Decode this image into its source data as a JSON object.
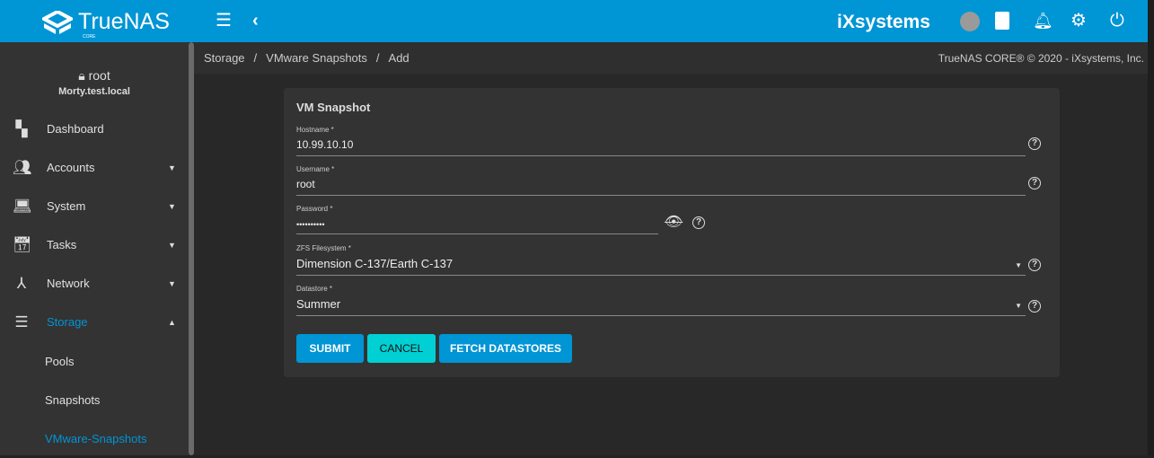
{
  "header": {
    "brand": "TrueNAS",
    "brand_sub": "CORE",
    "vendor": "iXsystems",
    "icons": [
      "menu-icon",
      "chevron-left-icon",
      "truecommand-icon",
      "clipboard-icon",
      "bell-icon",
      "gear-icon",
      "power-icon"
    ]
  },
  "sidebar": {
    "user": "root",
    "host": "Morty.test.local",
    "items": [
      {
        "label": "Dashboard"
      },
      {
        "label": "Accounts"
      },
      {
        "label": "System"
      },
      {
        "label": "Tasks"
      },
      {
        "label": "Network"
      },
      {
        "label": "Storage"
      }
    ],
    "subitems": [
      {
        "label": "Pools"
      },
      {
        "label": "Snapshots"
      },
      {
        "label": "VMware-Snapshots"
      }
    ]
  },
  "breadcrumb": [
    "Storage",
    "/",
    "VMware Snapshots",
    "/",
    "Add"
  ],
  "copyright": "TrueNAS CORE® © 2020 - iXsystems, Inc.",
  "form": {
    "title": "VM Snapshot",
    "hostname": {
      "label": "Hostname *",
      "value": "10.99.10.10"
    },
    "username": {
      "label": "Username *",
      "value": "root"
    },
    "password": {
      "label": "Password *",
      "value": "••••••••••"
    },
    "filesystem": {
      "label": "ZFS Filesystem *",
      "value": "Dimension C-137/Earth C-137"
    },
    "datastore": {
      "label": "Datastore *",
      "value": "Summer"
    },
    "submit": "SUBMIT",
    "cancel": "CANCEL",
    "fetch": "FETCH DATASTORES"
  },
  "colors": {
    "accent": "#0095d5",
    "cancel": "#00d0d3"
  }
}
